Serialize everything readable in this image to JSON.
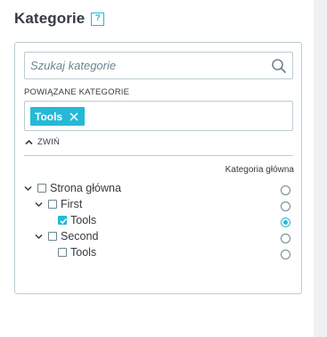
{
  "header": {
    "title": "Kategorie",
    "help_glyph": "?"
  },
  "search": {
    "placeholder": "Szukaj kategorie",
    "value": "",
    "icon": "search-icon"
  },
  "associated": {
    "label": "POWIĄZANE KATEGORIE",
    "tags": [
      {
        "label": "Tools",
        "remove_icon": "close-icon"
      }
    ]
  },
  "collapse": {
    "label": "ZWIŃ",
    "icon": "chevron-up-icon"
  },
  "tree": {
    "main_category_header": "Kategoria główna",
    "nodes": [
      {
        "label": "Strona główna",
        "level": 0,
        "expanded": true,
        "checked": false,
        "main": false
      },
      {
        "label": "First",
        "level": 1,
        "expanded": true,
        "checked": false,
        "main": false
      },
      {
        "label": "Tools",
        "level": 2,
        "expanded": false,
        "checked": true,
        "main": true
      },
      {
        "label": "Second",
        "level": 1,
        "expanded": true,
        "checked": false,
        "main": false
      },
      {
        "label": "Tools",
        "level": 2,
        "expanded": false,
        "checked": false,
        "main": false
      }
    ]
  },
  "colors": {
    "accent": "#25b9d7",
    "border": "#bbcdd2",
    "text": "#363a41",
    "muted": "#6c868e",
    "sidebar": "#eff1f2"
  }
}
